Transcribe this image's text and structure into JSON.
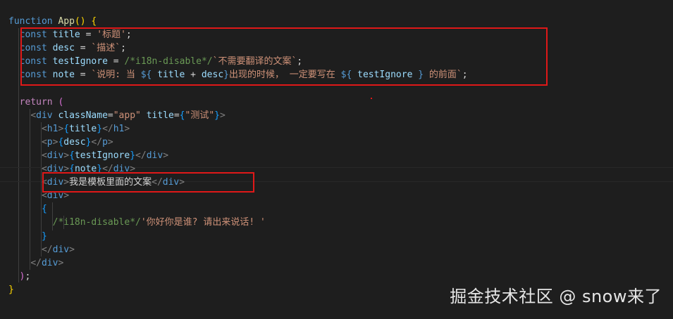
{
  "editor": {
    "lines": [
      {
        "text_parts": [
          [
            "kw",
            "function"
          ],
          [
            "punc",
            " "
          ],
          [
            "fn",
            "App"
          ],
          [
            "brace",
            "()"
          ],
          [
            "punc",
            " "
          ],
          [
            "brace",
            "{"
          ]
        ]
      },
      {
        "text_parts": [
          [
            "punc",
            "  "
          ],
          [
            "kw",
            "const"
          ],
          [
            "punc",
            " "
          ],
          [
            "var",
            "title"
          ],
          [
            "punc",
            " = "
          ],
          [
            "str",
            "'标题'"
          ],
          [
            "punc",
            ";"
          ]
        ]
      },
      {
        "text_parts": [
          [
            "punc",
            "  "
          ],
          [
            "kw",
            "const"
          ],
          [
            "punc",
            " "
          ],
          [
            "var",
            "desc"
          ],
          [
            "punc",
            " = "
          ],
          [
            "str",
            "`描述`"
          ],
          [
            "punc",
            ";"
          ]
        ]
      },
      {
        "text_parts": [
          [
            "punc",
            "  "
          ],
          [
            "kw",
            "const"
          ],
          [
            "punc",
            " "
          ],
          [
            "var",
            "testIgnore"
          ],
          [
            "punc",
            " = "
          ],
          [
            "cmt",
            "/*i18n-disable*/"
          ],
          [
            "str",
            "`不需要翻译的文案`"
          ],
          [
            "punc",
            ";"
          ]
        ]
      },
      {
        "text_parts": [
          [
            "punc",
            "  "
          ],
          [
            "kw",
            "const"
          ],
          [
            "punc",
            " "
          ],
          [
            "var",
            "note"
          ],
          [
            "punc",
            " = "
          ],
          [
            "str",
            "`说明: 当 "
          ],
          [
            "kw",
            "${"
          ],
          [
            "punc",
            " "
          ],
          [
            "var",
            "title"
          ],
          [
            "punc",
            " + "
          ],
          [
            "var",
            "desc"
          ],
          [
            "kw",
            "}"
          ],
          [
            "str",
            "出现的时候， 一定要写在 "
          ],
          [
            "kw",
            "${"
          ],
          [
            "punc",
            " "
          ],
          [
            "var",
            "testIgnore"
          ],
          [
            "punc",
            " "
          ],
          [
            "kw",
            "}"
          ],
          [
            "str",
            " 的前面`"
          ],
          [
            "punc",
            ";"
          ]
        ]
      },
      {
        "text_parts": [
          [
            "punc",
            ""
          ]
        ]
      },
      {
        "text_parts": [
          [
            "punc",
            "  "
          ],
          [
            "ctl",
            "return"
          ],
          [
            "punc",
            " "
          ],
          [
            "brace2",
            "("
          ]
        ]
      },
      {
        "text_parts": [
          [
            "punc",
            "    "
          ],
          [
            "tag",
            "<"
          ],
          [
            "tagname",
            "div"
          ],
          [
            "punc",
            " "
          ],
          [
            "attr",
            "className"
          ],
          [
            "punc",
            "="
          ],
          [
            "str",
            "\"app\""
          ],
          [
            "punc",
            " "
          ],
          [
            "attr",
            "title"
          ],
          [
            "punc",
            "="
          ],
          [
            "brace3",
            "{"
          ],
          [
            "str",
            "\"测试\""
          ],
          [
            "brace3",
            "}"
          ],
          [
            "tag",
            ">"
          ]
        ]
      },
      {
        "text_parts": [
          [
            "punc",
            "      "
          ],
          [
            "tag",
            "<"
          ],
          [
            "tagname",
            "h1"
          ],
          [
            "tag",
            ">"
          ],
          [
            "brace3",
            "{"
          ],
          [
            "var",
            "title"
          ],
          [
            "brace3",
            "}"
          ],
          [
            "tag",
            "</"
          ],
          [
            "tagname",
            "h1"
          ],
          [
            "tag",
            ">"
          ]
        ]
      },
      {
        "text_parts": [
          [
            "punc",
            "      "
          ],
          [
            "tag",
            "<"
          ],
          [
            "tagname",
            "p"
          ],
          [
            "tag",
            ">"
          ],
          [
            "brace3",
            "{"
          ],
          [
            "var",
            "desc"
          ],
          [
            "brace3",
            "}"
          ],
          [
            "tag",
            "</"
          ],
          [
            "tagname",
            "p"
          ],
          [
            "tag",
            ">"
          ]
        ]
      },
      {
        "text_parts": [
          [
            "punc",
            "      "
          ],
          [
            "tag",
            "<"
          ],
          [
            "tagname",
            "div"
          ],
          [
            "tag",
            ">"
          ],
          [
            "brace3",
            "{"
          ],
          [
            "var",
            "testIgnore"
          ],
          [
            "brace3",
            "}"
          ],
          [
            "tag",
            "</"
          ],
          [
            "tagname",
            "div"
          ],
          [
            "tag",
            ">"
          ]
        ]
      },
      {
        "text_parts": [
          [
            "punc",
            "      "
          ],
          [
            "tag",
            "<"
          ],
          [
            "tagname",
            "div"
          ],
          [
            "tag",
            ">"
          ],
          [
            "brace3",
            "{"
          ],
          [
            "var",
            "note"
          ],
          [
            "brace3",
            "}"
          ],
          [
            "tag",
            "</"
          ],
          [
            "tagname",
            "div"
          ],
          [
            "tag",
            ">"
          ]
        ]
      },
      {
        "text_parts": [
          [
            "punc",
            "      "
          ],
          [
            "tag",
            "<"
          ],
          [
            "tagname",
            "div"
          ],
          [
            "tag",
            ">"
          ],
          [
            "punc",
            "我是模板里面的文案"
          ],
          [
            "tag",
            "</"
          ],
          [
            "tagname",
            "div"
          ],
          [
            "tag",
            ">"
          ]
        ]
      },
      {
        "text_parts": [
          [
            "punc",
            "      "
          ],
          [
            "tag",
            "<"
          ],
          [
            "tagname",
            "div"
          ],
          [
            "tag",
            ">"
          ]
        ]
      },
      {
        "text_parts": [
          [
            "punc",
            "      "
          ],
          [
            "brace3",
            "{"
          ]
        ]
      },
      {
        "text_parts": [
          [
            "punc",
            "        "
          ],
          [
            "cmt",
            "/*i18n-disable*/"
          ],
          [
            "str",
            "'你好你是谁? 请出来说话! '"
          ]
        ]
      },
      {
        "text_parts": [
          [
            "punc",
            "      "
          ],
          [
            "brace3",
            "}"
          ]
        ]
      },
      {
        "text_parts": [
          [
            "punc",
            "      "
          ],
          [
            "tag",
            "</"
          ],
          [
            "tagname",
            "div"
          ],
          [
            "tag",
            ">"
          ]
        ]
      },
      {
        "text_parts": [
          [
            "punc",
            "    "
          ],
          [
            "tag",
            "</"
          ],
          [
            "tagname",
            "div"
          ],
          [
            "tag",
            ">"
          ]
        ]
      },
      {
        "text_parts": [
          [
            "punc",
            "  "
          ],
          [
            "brace2",
            ")"
          ],
          [
            "punc",
            ";"
          ]
        ]
      },
      {
        "text_parts": [
          [
            "brace",
            "}"
          ]
        ]
      }
    ]
  },
  "watermark": "掘金技术社区 @ snow来了",
  "colors": {
    "background": "#1e1e1e",
    "highlight_box": "#e01818"
  }
}
